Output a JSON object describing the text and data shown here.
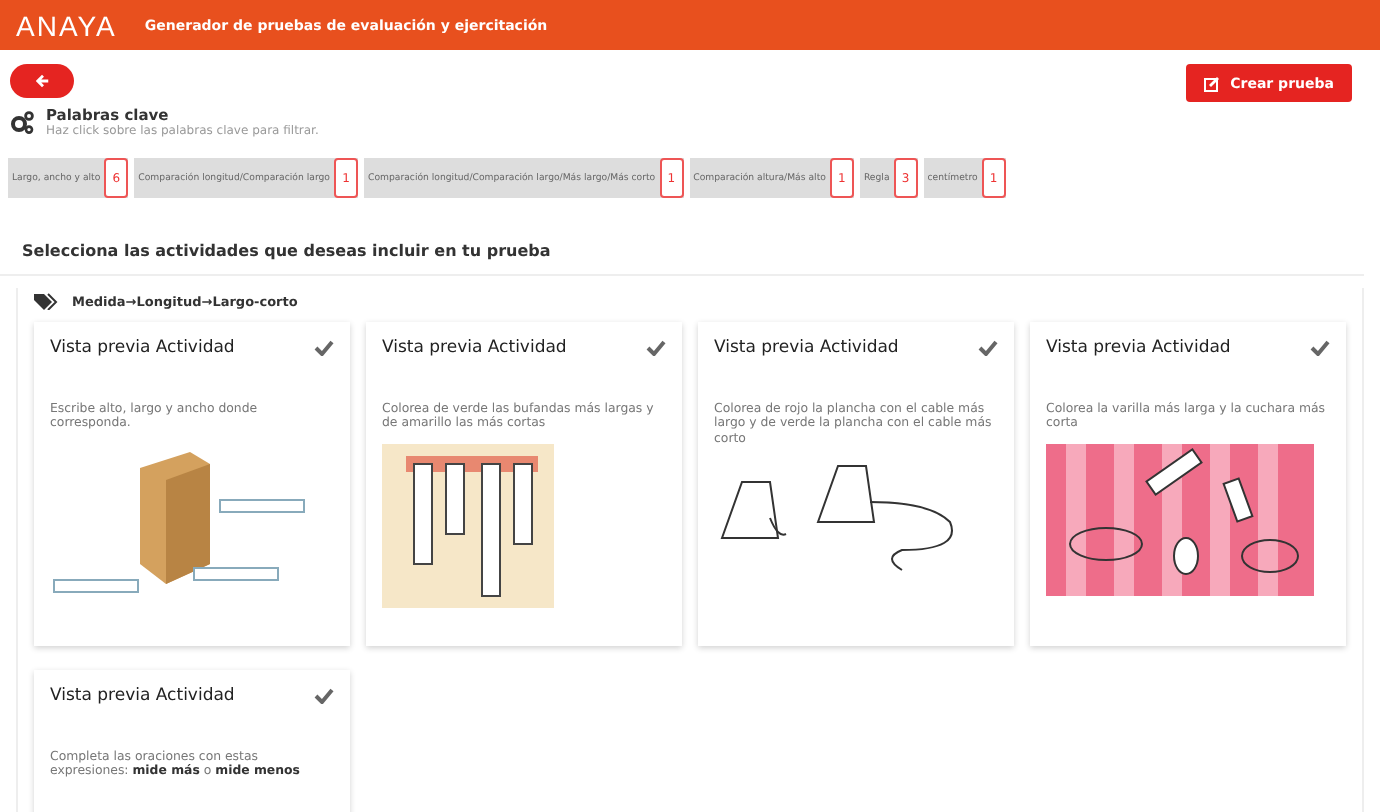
{
  "header": {
    "logo": "ANAYA",
    "title": "Generador de pruebas de evaluación y ejercitación"
  },
  "create_button": {
    "label": "Crear prueba"
  },
  "keywords": {
    "title": "Palabras clave",
    "hint": "Haz click sobre las palabras clave para filtrar.",
    "items": [
      {
        "label": "Largo, ancho y alto",
        "count": "6"
      },
      {
        "label": "Comparación longitud/Comparación largo",
        "count": "1"
      },
      {
        "label": "Comparación longitud/Comparación largo/Más largo/Más corto",
        "count": "1"
      },
      {
        "label": "Comparación altura/Más alto",
        "count": "1"
      },
      {
        "label": "Regla",
        "count": "3"
      },
      {
        "label": "centímetro",
        "count": "1"
      }
    ]
  },
  "section_title": "Selecciona las actividades que deseas incluir en tu prueba",
  "category": "Medida→Longitud→Largo-corto",
  "activities": [
    {
      "title": "Vista previa Actividad",
      "description": "Escribe alto, largo y ancho donde corresponda.",
      "kind": "box"
    },
    {
      "title": "Vista previa Actividad",
      "description": "Colorea de verde las bufandas más largas y de amarillo las más cortas",
      "kind": "scarves"
    },
    {
      "title": "Vista previa Actividad",
      "description": "Colorea de rojo la plancha con el cable más largo y de verde la plancha con el cable más corto",
      "kind": "irons"
    },
    {
      "title": "Vista previa Actividad",
      "description": "Colorea la varilla más larga y la cuchara más corta",
      "kind": "utensils"
    },
    {
      "title": "Vista previa Actividad",
      "description": "Completa las oraciones con estas expresiones: **mide más** o **mide menos**",
      "kind": "text"
    }
  ]
}
